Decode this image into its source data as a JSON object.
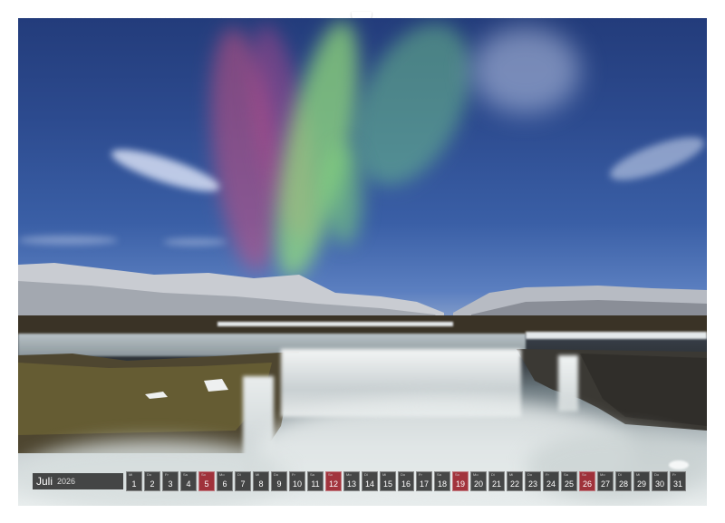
{
  "calendar": {
    "month": "Juli",
    "year": "2026",
    "days": [
      {
        "weekday": "Mi",
        "day": "1"
      },
      {
        "weekday": "Do",
        "day": "2"
      },
      {
        "weekday": "Fr",
        "day": "3"
      },
      {
        "weekday": "Sa",
        "day": "4"
      },
      {
        "weekday": "So",
        "day": "5"
      },
      {
        "weekday": "Mo",
        "day": "6"
      },
      {
        "weekday": "Di",
        "day": "7"
      },
      {
        "weekday": "Mi",
        "day": "8"
      },
      {
        "weekday": "Do",
        "day": "9"
      },
      {
        "weekday": "Fr",
        "day": "10"
      },
      {
        "weekday": "Sa",
        "day": "11"
      },
      {
        "weekday": "So",
        "day": "12"
      },
      {
        "weekday": "Mo",
        "day": "13"
      },
      {
        "weekday": "Di",
        "day": "14"
      },
      {
        "weekday": "Mi",
        "day": "15"
      },
      {
        "weekday": "Do",
        "day": "16"
      },
      {
        "weekday": "Fr",
        "day": "17"
      },
      {
        "weekday": "Sa",
        "day": "18"
      },
      {
        "weekday": "So",
        "day": "19"
      },
      {
        "weekday": "Mo",
        "day": "20"
      },
      {
        "weekday": "Di",
        "day": "21"
      },
      {
        "weekday": "Mi",
        "day": "22"
      },
      {
        "weekday": "Do",
        "day": "23"
      },
      {
        "weekday": "Fr",
        "day": "24"
      },
      {
        "weekday": "Sa",
        "day": "25"
      },
      {
        "weekday": "So",
        "day": "26"
      },
      {
        "weekday": "Mo",
        "day": "27"
      },
      {
        "weekday": "Di",
        "day": "28"
      },
      {
        "weekday": "Mi",
        "day": "29"
      },
      {
        "weekday": "Do",
        "day": "30"
      },
      {
        "weekday": "Fr",
        "day": "31"
      }
    ]
  },
  "colors": {
    "sunday_cell": "#96141e",
    "day_cell": "#191919",
    "aurora_green": "#9be67a",
    "aurora_magenta": "#c0507a"
  }
}
